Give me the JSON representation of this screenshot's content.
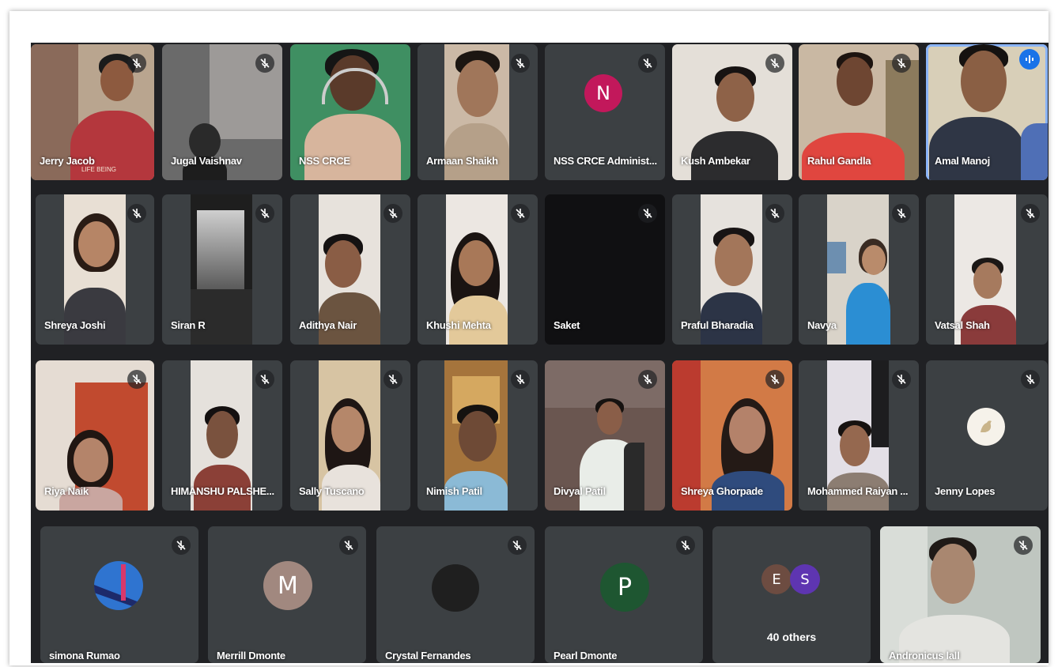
{
  "meeting": {
    "participants": [
      {
        "name": "Jerry Jacob",
        "muted": true,
        "shirt_text": "LIFE BEING"
      },
      {
        "name": "Jugal Vaishnav",
        "muted": true
      },
      {
        "name": "NSS CRCE",
        "muted": false
      },
      {
        "name": "Armaan Shaikh",
        "muted": true
      },
      {
        "name": "NSS CRCE Administ...",
        "muted": true,
        "avatar_letter": "N",
        "avatar_color": "#c2185b"
      },
      {
        "name": "Kush Ambekar",
        "muted": true
      },
      {
        "name": "Rahul Gandla",
        "muted": true
      },
      {
        "name": "Amal Manoj",
        "muted": false,
        "speaking": true
      },
      {
        "name": "Shreya Joshi",
        "muted": true
      },
      {
        "name": "Siran R",
        "muted": true
      },
      {
        "name": "Adithya Nair",
        "muted": true
      },
      {
        "name": "Khushi Mehta",
        "muted": true
      },
      {
        "name": "Saket",
        "muted": true
      },
      {
        "name": "Praful Bharadia",
        "muted": true
      },
      {
        "name": "Navya",
        "muted": true
      },
      {
        "name": "Vatsal Shah",
        "muted": true
      },
      {
        "name": "Riya Naik",
        "muted": true
      },
      {
        "name": "HIMANSHU PALSHE...",
        "muted": true
      },
      {
        "name": "Sally Tuscano",
        "muted": true
      },
      {
        "name": "Nimish Patil",
        "muted": true
      },
      {
        "name": "Divyal Patil",
        "muted": true
      },
      {
        "name": "Shreya Ghorpade",
        "muted": true
      },
      {
        "name": "Mohammed Raiyan ...",
        "muted": true
      },
      {
        "name": "Jenny Lopes",
        "muted": true
      },
      {
        "name": "simona Rumao",
        "muted": true
      },
      {
        "name": "Merrill Dmonte",
        "muted": true,
        "avatar_letter": "M",
        "avatar_color": "#a1887f"
      },
      {
        "name": "Crystal Fernandes",
        "muted": true
      },
      {
        "name": "Pearl Dmonte",
        "muted": true,
        "avatar_letter": "P",
        "avatar_color": "#1e5631"
      },
      {
        "name": "Andronicus lall",
        "muted": true
      }
    ],
    "others_tile": {
      "label": "40 others",
      "avatars": [
        {
          "letter": "E",
          "color": "#6d4c41"
        },
        {
          "letter": "S",
          "color": "#5e35b1"
        }
      ]
    }
  },
  "colors": {
    "stage_bg": "#202124",
    "tile_bg": "#3c4043",
    "active_speaker_border": "#8ab4f8",
    "speaking_badge": "#1a73e8"
  }
}
